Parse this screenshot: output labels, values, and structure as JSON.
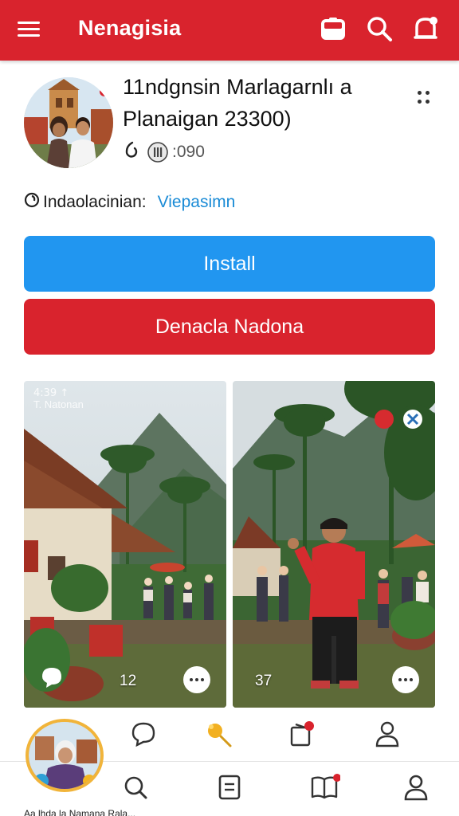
{
  "app_bar": {
    "title": "Nenagisia",
    "background_color": "#d9232d",
    "icons": [
      "menu-icon",
      "store-icon",
      "search-icon",
      "notification-bell-icon"
    ]
  },
  "app": {
    "title": "11ndgnsin Marlagarnlı a",
    "subtitle": "Planaigan 23300)",
    "meta_value": ":090",
    "info_label": "Indaolacinian:",
    "info_link": "Viepasimn"
  },
  "buttons": {
    "install": "Install",
    "secondary": "Denacla Nadona"
  },
  "colors": {
    "brand_red": "#d9232d",
    "install_blue": "#2196f0",
    "link_blue": "#1a8bd6"
  },
  "screenshots": [
    {
      "status": "4:39 ↑",
      "caption": "T. Natonan",
      "count": "12"
    },
    {
      "status": "",
      "caption": "",
      "count": "37"
    }
  ],
  "sub_nav": [
    "chat-bubble-icon",
    "sparkle-wand-icon",
    "notice-icon",
    "profile-icon"
  ],
  "bottom_nav": [
    "search-icon",
    "document-icon",
    "book-icon",
    "account-icon"
  ],
  "bottom_cut_text": "Aa lhda la Namana Rala..."
}
